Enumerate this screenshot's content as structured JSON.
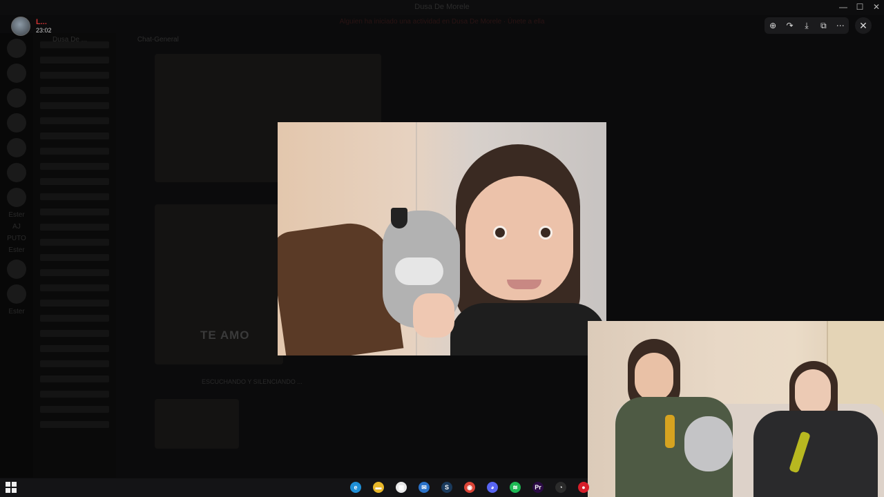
{
  "window": {
    "title": "Dusa De Morele",
    "minimize": "—",
    "maximize": "☐",
    "close": "✕"
  },
  "backdrop": {
    "banner": "Alguien ha iniciado una actividad en Dusa De Morele  ·  Únete a ella",
    "server_label": "Dusa De ...",
    "channel_name": "Chat-General",
    "side_labels": [
      "Ester",
      "AJ",
      "PUTO",
      "Ester",
      "Ester"
    ],
    "ghost_caption": "TE AMO",
    "ghost_status": "ESCUCHANDO Y SILENCIANDO ..."
  },
  "viewer": {
    "uploader_name": "L...",
    "uploader_time": "23:02",
    "toolbar_icons": [
      "zoom-icon",
      "forward-icon",
      "download-icon",
      "open-external-icon",
      "more-icon"
    ],
    "toolbar_glyphs": [
      "⊕",
      "↷",
      "⤓",
      "⧉",
      "⋯"
    ],
    "close_glyph": "✕"
  },
  "taskbar": {
    "start_icon": "windows-start-icon",
    "apps": [
      {
        "name": "edge",
        "glyph": "e",
        "color": "#1f8fd6"
      },
      {
        "name": "file-explorer",
        "glyph": "▬",
        "color": "#e8b729"
      },
      {
        "name": "store",
        "glyph": "▦",
        "color": "#e8e8e8"
      },
      {
        "name": "mail",
        "glyph": "✉",
        "color": "#2a72c9"
      },
      {
        "name": "steam",
        "glyph": "S",
        "color": "#1a3a5c"
      },
      {
        "name": "chrome",
        "glyph": "◉",
        "color": "#db4437"
      },
      {
        "name": "discord",
        "glyph": "◕",
        "color": "#5865f2"
      },
      {
        "name": "spotify",
        "glyph": "≋",
        "color": "#1db954"
      },
      {
        "name": "premiere",
        "glyph": "Pr",
        "color": "#2a0a44"
      },
      {
        "name": "obs",
        "glyph": "◔",
        "color": "#2b2b2b"
      },
      {
        "name": "app-red",
        "glyph": "●",
        "color": "#d81e2a"
      }
    ]
  }
}
